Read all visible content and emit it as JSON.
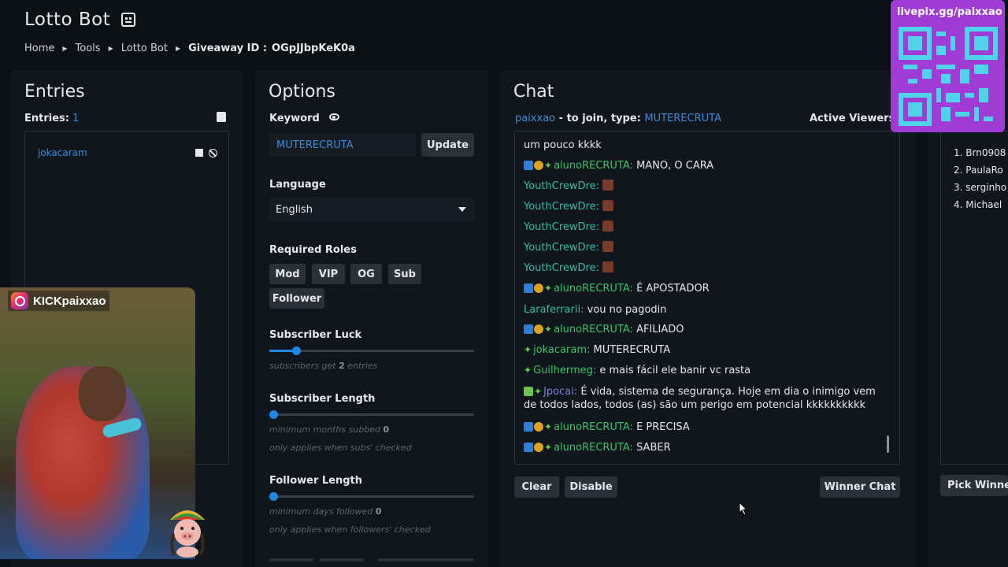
{
  "header": {
    "title": "Lotto Bot",
    "breadcrumb": [
      "Home",
      "Tools",
      "Lotto Bot"
    ],
    "giveaway_label": "Giveaway ID :",
    "giveaway_id": "OGpJJbpKeK0a"
  },
  "entries": {
    "title": "Entries",
    "label": "Entries:",
    "count": "1",
    "items": [
      {
        "name": "jokacaram"
      }
    ]
  },
  "options": {
    "title": "Options",
    "keyword_label": "Keyword",
    "keyword_value": "MUTERECRUTA",
    "update_label": "Update",
    "language_label": "Language",
    "language_value": "English",
    "roles_label": "Required Roles",
    "roles": [
      "Mod",
      "VIP",
      "OG",
      "Sub",
      "Follower"
    ],
    "subscriber_luck": {
      "label": "Subscriber Luck",
      "hint_prefix": "subscribers get",
      "value": "2",
      "hint_suffix": "entries",
      "slider_fraction": 0.13
    },
    "subscriber_length": {
      "label": "Subscriber Length",
      "hint_prefix": "minimum months subbed",
      "value": "0",
      "note": "only applies when subs' checked",
      "slider_fraction": 0.02
    },
    "follower_length": {
      "label": "Follower Length",
      "hint_prefix": "minimum days followed",
      "value": "0",
      "note": "only applies when followers' checked",
      "slider_fraction": 0.02
    }
  },
  "chat": {
    "title": "Chat",
    "channel": "paixxao",
    "join_text": "- to join, type:",
    "keyword": "MUTERECRUTA",
    "active_viewers_label": "Active Viewers:",
    "messages": [
      {
        "user": "",
        "text": "um pouco kkkk"
      },
      {
        "user": "alunoRECRUTA:",
        "text": "MANO, O CARA"
      },
      {
        "user": "YouthCrewDre:",
        "text": ""
      },
      {
        "user": "YouthCrewDre:",
        "text": ""
      },
      {
        "user": "YouthCrewDre:",
        "text": ""
      },
      {
        "user": "YouthCrewDre:",
        "text": ""
      },
      {
        "user": "YouthCrewDre:",
        "text": ""
      },
      {
        "user": "alunoRECRUTA:",
        "text": "É APOSTADOR"
      },
      {
        "user": "Laraferrarii:",
        "text": "vou no pagodin"
      },
      {
        "user": "alunoRECRUTA:",
        "text": "AFILIADO"
      },
      {
        "user": "jokacaram:",
        "text": "MUTERECRUTA"
      },
      {
        "user": "Guilhermeg:",
        "text": "e mais fácil ele banir vc rasta"
      },
      {
        "user": "Jpocai:",
        "text": "É vida, sistema de segurança. Hoje em dia o inimigo vem de todos lados, todos (as) são um perigo em potencial kkkkkkkkkk"
      },
      {
        "user": "alunoRECRUTA:",
        "text": "E PRECISA"
      },
      {
        "user": "alunoRECRUTA:",
        "text": "SABER"
      }
    ],
    "clear_label": "Clear",
    "disable_label": "Disable",
    "winner_chat_label": "Winner Chat"
  },
  "winners": {
    "items": [
      "1.",
      "2.",
      "3.",
      "4."
    ],
    "names": [
      "Brn0908",
      "PaulaRo",
      "serginho",
      "Michael"
    ],
    "pick_label": "Pick Winner"
  },
  "overlay": {
    "qr_url": "livepix.gg/paixxao",
    "brand": "KICKpaixxao"
  }
}
